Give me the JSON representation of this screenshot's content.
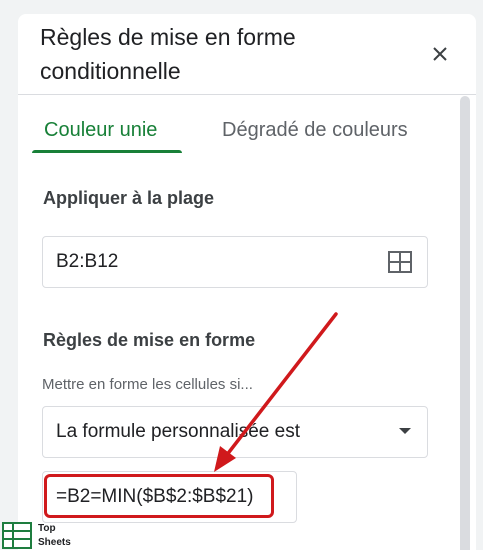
{
  "dialog": {
    "title": "Règles de mise en forme conditionnelle",
    "close_icon": "close-icon"
  },
  "tabs": [
    {
      "label": "Couleur unie",
      "active": true
    },
    {
      "label": "Dégradé de couleurs",
      "active": false
    }
  ],
  "apply_range": {
    "heading": "Appliquer à la plage",
    "value": "B2:B12",
    "icon": "grid-select-icon"
  },
  "format_rules": {
    "heading": "Règles de mise en forme",
    "hint": "Mettre en forme les cellules si...",
    "condition": "La formule personnalisée est",
    "formula": "=B2=MIN($B$2:$B$21)"
  },
  "logo": {
    "line1": "Top",
    "line2": "Sheets"
  },
  "colors": {
    "accent": "#188038",
    "highlight": "#d0191c",
    "border": "#dadce0"
  }
}
